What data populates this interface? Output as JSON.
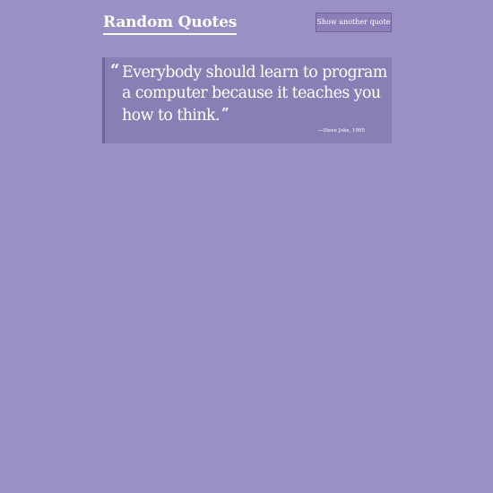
{
  "header": {
    "title": "Random Quotes",
    "new_quote_label": "Show another quote"
  },
  "quote": {
    "open_mark": "“",
    "text": "Everybody should learn to program a computer because it teaches you how to think.",
    "close_mark": "”",
    "attribution": "—Steve Jobs, 1995"
  },
  "colors": {
    "background": "#9b90c6",
    "card": "#8a7fb5",
    "card_border": "#6f649c",
    "button": "#8a7db8",
    "text": "#ffffff"
  }
}
